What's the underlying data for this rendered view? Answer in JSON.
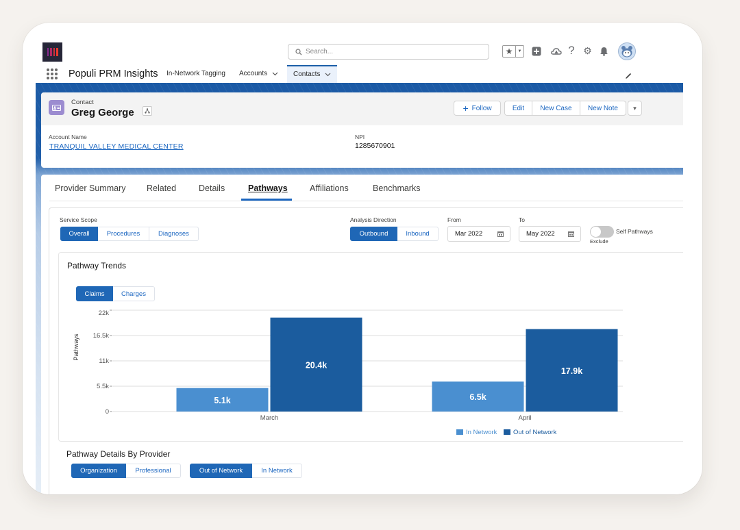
{
  "app": {
    "name": "Populi PRM Insights",
    "logo": "populi-logo"
  },
  "search": {
    "placeholder": "Search..."
  },
  "header_icons": [
    "favorites-star-icon",
    "global-add-icon",
    "trailhead-cloud-icon",
    "help-icon",
    "setup-gear-icon",
    "notifications-bell-icon",
    "user-avatar"
  ],
  "nav": {
    "selected": "Contacts",
    "items": [
      {
        "label": "In-Network Tagging",
        "has_menu": false
      },
      {
        "label": "Accounts",
        "has_menu": true
      },
      {
        "label": "Contacts",
        "has_menu": true
      }
    ],
    "edit_icon": "pencil-icon"
  },
  "record": {
    "object_type": "Contact",
    "name": "Greg George",
    "actions": {
      "follow": "Follow",
      "edit": "Edit",
      "new_case": "New Case",
      "new_note": "New Note"
    },
    "fields": [
      {
        "label": "Account Name",
        "value": "TRANQUIL VALLEY MEDICAL CENTER",
        "is_link": true
      },
      {
        "label": "NPI",
        "value": "1285670901",
        "is_link": false
      }
    ]
  },
  "tabs": {
    "selected": "Pathways",
    "items": [
      "Provider Summary",
      "Related",
      "Details",
      "Pathways",
      "Affiliations",
      "Benchmarks"
    ]
  },
  "filters": {
    "service_scope": {
      "label": "Service Scope",
      "options": [
        "Overall",
        "Procedures",
        "Diagnoses"
      ],
      "selected": "Overall"
    },
    "analysis_direction": {
      "label": "Analysis Direction",
      "options": [
        "Outbound",
        "Inbound"
      ],
      "selected": "Outbound"
    },
    "from": {
      "label": "From",
      "value": "Mar 2022"
    },
    "to": {
      "label": "To",
      "value": "May 2022"
    },
    "self_pathways": {
      "label": "Self Pathways",
      "sublabel": "Exclude",
      "enabled": false
    }
  },
  "trends": {
    "title": "Pathway Trends",
    "metric": {
      "options": [
        "Claims",
        "Charges"
      ],
      "selected": "Claims"
    }
  },
  "chart_data": {
    "type": "bar",
    "title": "Pathway Trends",
    "xlabel": "",
    "ylabel": "Pathways",
    "categories": [
      "March",
      "April"
    ],
    "series": [
      {
        "name": "In Network",
        "values": [
          5100,
          6500
        ],
        "labels": [
          "5.1k",
          "6.5k"
        ],
        "color": "#4a8fd0"
      },
      {
        "name": "Out of Network",
        "values": [
          20400,
          17900
        ],
        "labels": [
          "20.4k",
          "17.9k"
        ],
        "color": "#1b5c9e"
      }
    ],
    "ylim": [
      0,
      22000
    ],
    "yticks": [
      {
        "value": 0,
        "label": "0"
      },
      {
        "value": 5500,
        "label": "5.5k"
      },
      {
        "value": 11000,
        "label": "11k"
      },
      {
        "value": 16500,
        "label": "16.5k"
      },
      {
        "value": 22000,
        "label": "22k"
      }
    ],
    "grid": true,
    "legend": "bottom-center"
  },
  "details": {
    "title": "Pathway Details By Provider",
    "provider_type": {
      "options": [
        "Organization",
        "Professional"
      ],
      "selected": "Organization"
    },
    "network": {
      "options": [
        "Out of Network",
        "In Network"
      ],
      "selected": "Out of Network"
    }
  },
  "colors": {
    "brand_blue": "#1b5aa5",
    "active_button": "#1f67b6",
    "link": "#1b66c0",
    "in_network": "#4a8fd0",
    "out_of_network": "#1b5c9e",
    "contact_icon": "#9c8cd0"
  }
}
